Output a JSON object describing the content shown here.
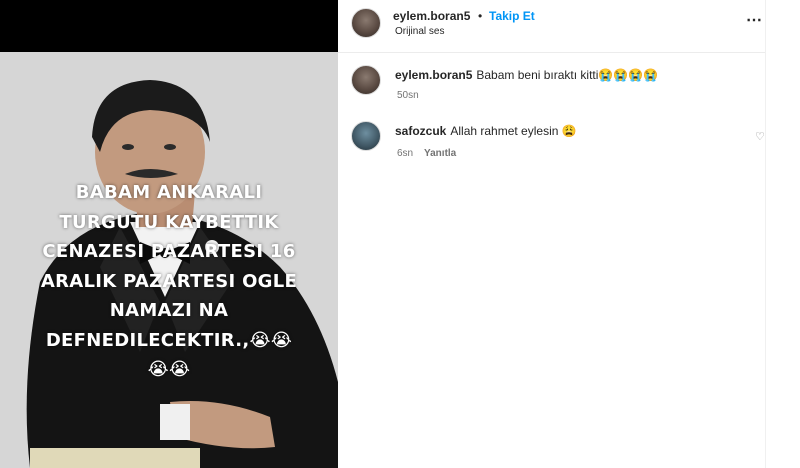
{
  "post": {
    "username": "eylem.boran5",
    "separator": "•",
    "follow_label": "Takip Et",
    "audio_label": "Orijinal ses",
    "more_icon": "⋯"
  },
  "overlay_text": {
    "lines": [
      "BABAM ANKARALI",
      "TURGUTU KAYBETTIK",
      "CENAZESI PAZARTESI 16",
      "ARALIK PAZARTESI OGLE",
      "NAMAZI NA",
      "DEFNEDILECEKTIR.,😭😭",
      "😭😭"
    ]
  },
  "comments": [
    {
      "username": "eylem.boran5",
      "text": "Babam beni bıraktı kitti😭😭😭😭",
      "time": "50sn"
    },
    {
      "username": "safozcuk",
      "text": "Allah rahmet eylesin 😩",
      "time": "6sn",
      "reply_label": "Yanıtla"
    }
  ],
  "colors": {
    "accent_link": "#0095f6",
    "text_primary": "#262626",
    "text_secondary": "#737373"
  }
}
